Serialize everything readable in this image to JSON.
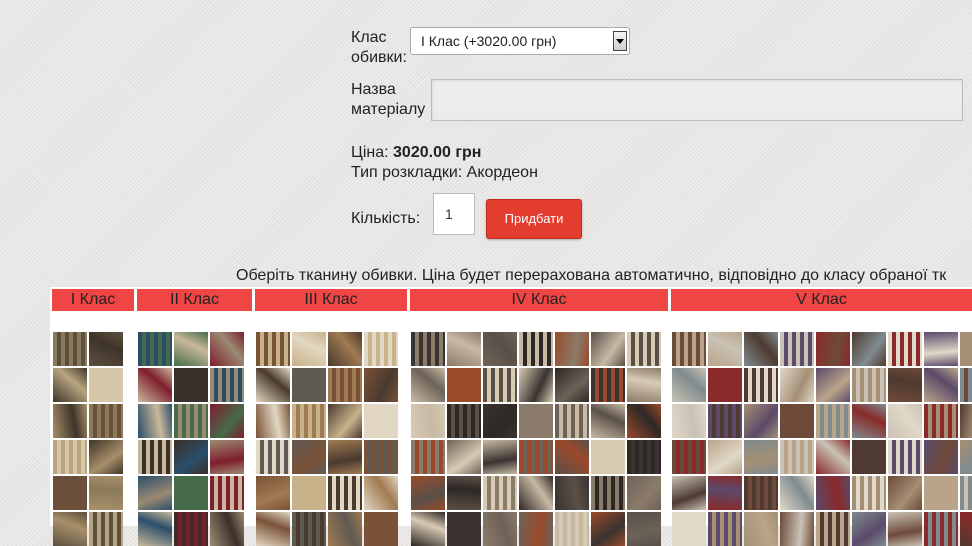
{
  "form": {
    "upholstery_class_label": "Клас обивки:",
    "upholstery_class_label_line1": "Клас",
    "upholstery_class_label_line2": "обивки:",
    "upholstery_class_value": "I Клас (+3020.00 грн)",
    "material_label_line1": "Назва",
    "material_label_line2": "матеріалу",
    "material_value": "",
    "price_label": "Ціна:",
    "price_value": "3020.00 грн",
    "layout_type_label": "Тип розкладки:",
    "layout_type_value": "Акордеон",
    "quantity_label": "Кількість:",
    "quantity_value": "1",
    "buy_label": "Придбати"
  },
  "fabrics": {
    "note": "Оберіть тканину обивки. Ціна будет перерахована автоматично, відповідно до класу обраної тк",
    "classes": [
      "I Клас",
      "II Клас",
      "III Клас",
      "IV Клас",
      "V Клас"
    ],
    "header_color": "#f04545"
  },
  "colors": {
    "buy_button": "#e33d30",
    "class_header": "#f04545"
  }
}
